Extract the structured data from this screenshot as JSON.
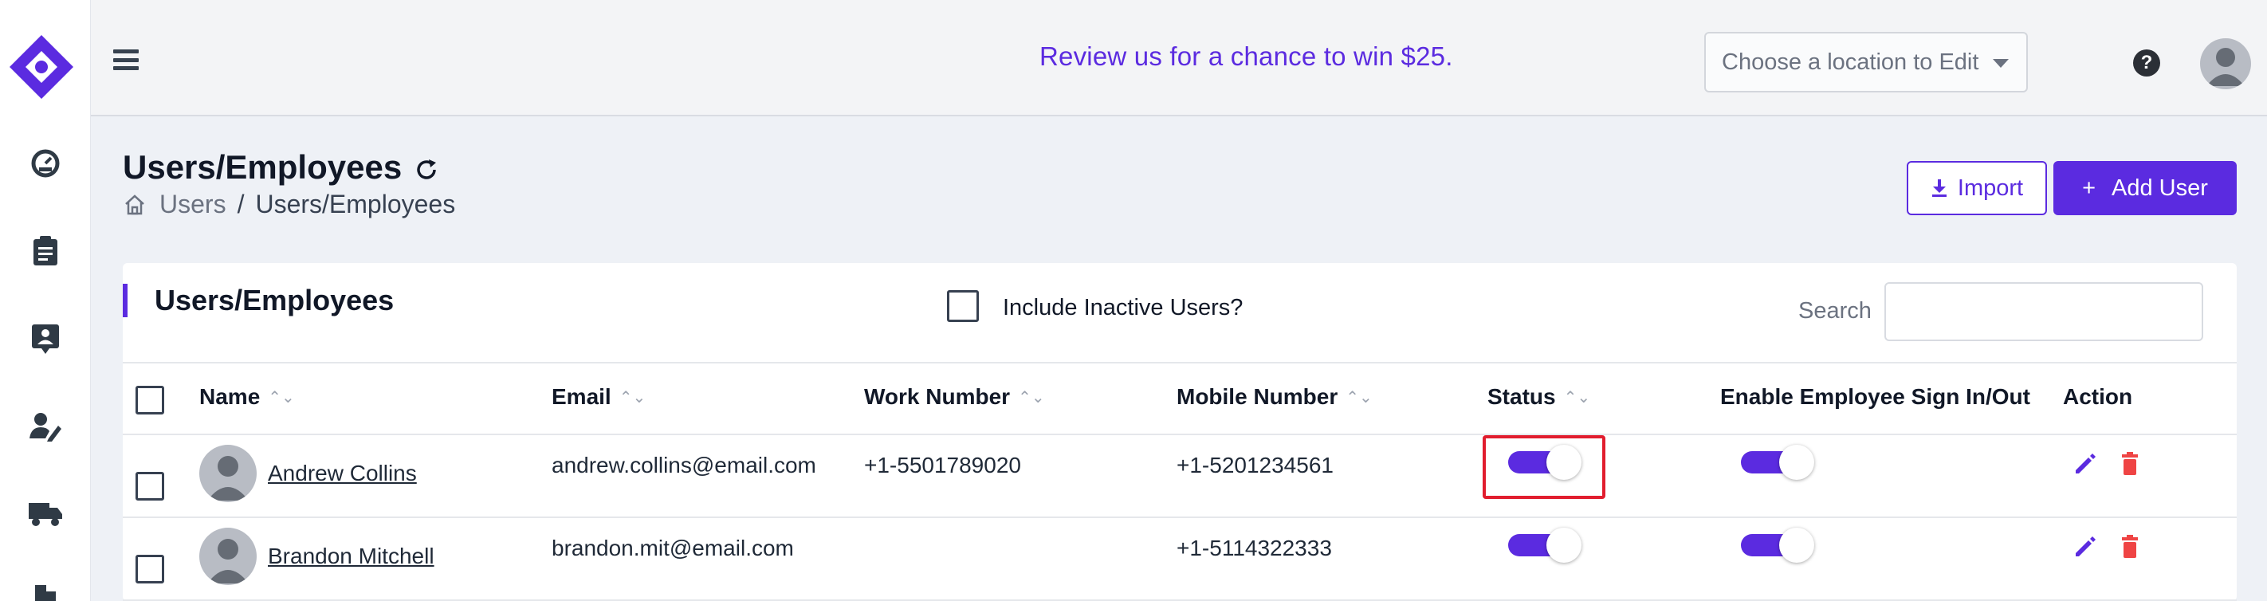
{
  "header": {
    "promo": "Review us for a chance to win $25.",
    "location_placeholder": "Choose a location to Edit",
    "help": "?"
  },
  "page": {
    "title": "Users/Employees",
    "breadcrumb": [
      "Users",
      "/",
      "Users/Employees"
    ],
    "import_label": "Import",
    "add_user_label": "Add User",
    "add_user_plus": "+"
  },
  "card": {
    "title": "Users/Employees",
    "include_inactive": "Include Inactive Users?",
    "search_label": "Search"
  },
  "table": {
    "columns": [
      "Name",
      "Email",
      "Work Number",
      "Mobile Number",
      "Status",
      "Enable Employee Sign In/Out",
      "Action"
    ],
    "sort_glyph": "⌃⌄",
    "rows": [
      {
        "name": "Andrew Collins",
        "email": "andrew.collins@email.com",
        "work": "+1-5501789020",
        "mobile": "+1-5201234561",
        "status_on": true,
        "signin_on": true
      },
      {
        "name": "Brandon Mitchell",
        "email": "brandon.mit@email.com",
        "work": "",
        "mobile": "+1-5114322333",
        "status_on": true,
        "signin_on": true
      }
    ]
  },
  "colors": {
    "accent": "#5b2be0",
    "highlight": "#e11d2e",
    "delete": "#ef4444"
  },
  "icons": [
    "logo-icon",
    "dashboard-icon",
    "clipboard-icon",
    "contact-card-icon",
    "user-edit-icon",
    "truck-icon",
    "menu-icon",
    "refresh-icon",
    "home-icon",
    "download-icon",
    "help-icon",
    "avatar-icon",
    "edit-icon",
    "trash-icon"
  ]
}
